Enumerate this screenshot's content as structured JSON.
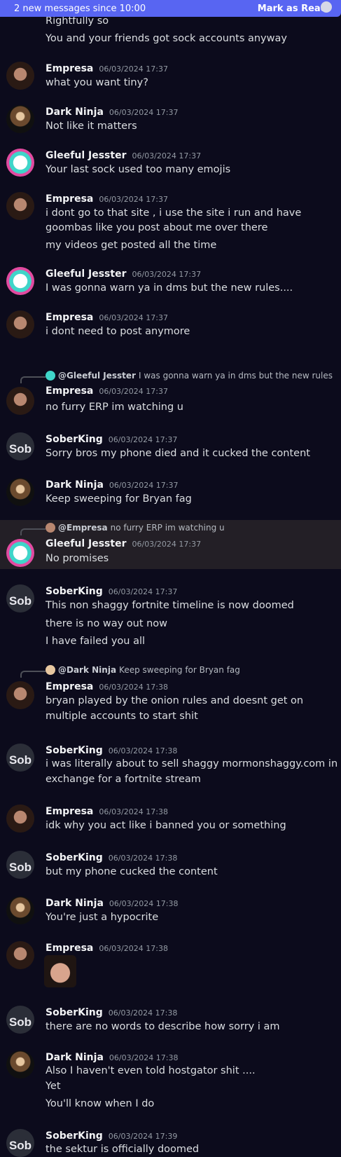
{
  "banner": {
    "text": "2 new messages since 10:00",
    "mark": "Mark as Read"
  },
  "messages": [
    {
      "author": "",
      "time": "",
      "lines": [
        "Rightfully so",
        "You and your friends got sock accounts anyway"
      ]
    },
    {
      "author": "Empresa",
      "time": "06/03/2024 17:37",
      "lines": [
        "what you want tiny?"
      ]
    },
    {
      "author": "Dark Ninja",
      "time": "06/03/2024 17:37",
      "lines": [
        "Not like it matters"
      ]
    },
    {
      "author": "Gleeful Jesster",
      "time": "06/03/2024 17:37",
      "lines": [
        "Your last sock used too many emojis"
      ]
    },
    {
      "author": "Empresa",
      "time": "06/03/2024 17:37",
      "lines": [
        "i dont go to that site , i use the site i run and have",
        "goombas like you post about me over there",
        "my videos get posted all the time"
      ]
    },
    {
      "author": "Gleeful Jesster",
      "time": "06/03/2024 17:37",
      "lines": [
        "I was gonna warn ya in dms but the new rules...."
      ]
    },
    {
      "author": "Empresa",
      "time": "06/03/2024 17:37",
      "lines": [
        "i dont need to post anymore"
      ]
    },
    {
      "reply": {
        "name": "@Gleeful Jesster",
        "text": "I was gonna warn ya in dms but the new rules...."
      },
      "author": "Empresa",
      "time": "06/03/2024 17:37",
      "lines": [
        "no furry ERP im watching u"
      ]
    },
    {
      "author": "SoberKing",
      "time": "06/03/2024 17:37",
      "lines": [
        "Sorry bros my phone died and it cucked the content"
      ]
    },
    {
      "author": "Dark Ninja",
      "time": "06/03/2024 17:37",
      "lines": [
        "Keep sweeping for Bryan fag"
      ]
    },
    {
      "reply": {
        "name": "@Empresa",
        "text": "no furry ERP im watching u"
      },
      "author": "Gleeful Jesster",
      "time": "06/03/2024 17:37",
      "lines": [
        "No promises"
      ]
    },
    {
      "author": "SoberKing",
      "time": "06/03/2024 17:37",
      "lines": [
        "This non shaggy fortnite timeline is now doomed",
        "there is no way out now",
        "I have failed you all"
      ]
    },
    {
      "reply": {
        "name": "@Dark Ninja",
        "text": "Keep sweeping for Bryan fag"
      },
      "author": "Empresa",
      "time": "06/03/2024 17:38",
      "lines": [
        "bryan played by the onion rules and doesnt get on",
        "multiple accounts to start shit"
      ]
    },
    {
      "author": "SoberKing",
      "time": "06/03/2024 17:38",
      "lines": [
        "i was literally about to sell shaggy mormonshaggy.com in",
        "exchange for a fortnite stream"
      ]
    },
    {
      "author": "Empresa",
      "time": "06/03/2024 17:38",
      "lines": [
        "idk why you act like i banned you or something"
      ]
    },
    {
      "author": "SoberKing",
      "time": "06/03/2024 17:38",
      "lines": [
        "but my phone cucked the content"
      ]
    },
    {
      "author": "Dark Ninja",
      "time": "06/03/2024 17:38",
      "lines": [
        "You're just a hypocrite"
      ]
    },
    {
      "author": "Empresa",
      "time": "06/03/2024 17:38",
      "lines": []
    },
    {
      "author": "SoberKing",
      "time": "06/03/2024 17:38",
      "lines": [
        "there are no words to describe how sorry i am"
      ]
    },
    {
      "author": "Dark Ninja",
      "time": "06/03/2024 17:38",
      "lines": [
        "Also I haven't even told hostgator shit ....",
        "Yet",
        "You'll know when I do"
      ]
    },
    {
      "author": "SoberKing",
      "time": "06/03/2024 17:39",
      "lines": [
        "the sektur is officially doomed"
      ]
    }
  ],
  "avatar_colors": {
    "Empresa": "#b88770",
    "Dark Ninja": "#e7c7a0",
    "Gleeful Jesster": "#3fd5c9",
    "SoberKing": "#2b2e38"
  },
  "avatar_text": {
    "SoberKing": "Sob"
  }
}
